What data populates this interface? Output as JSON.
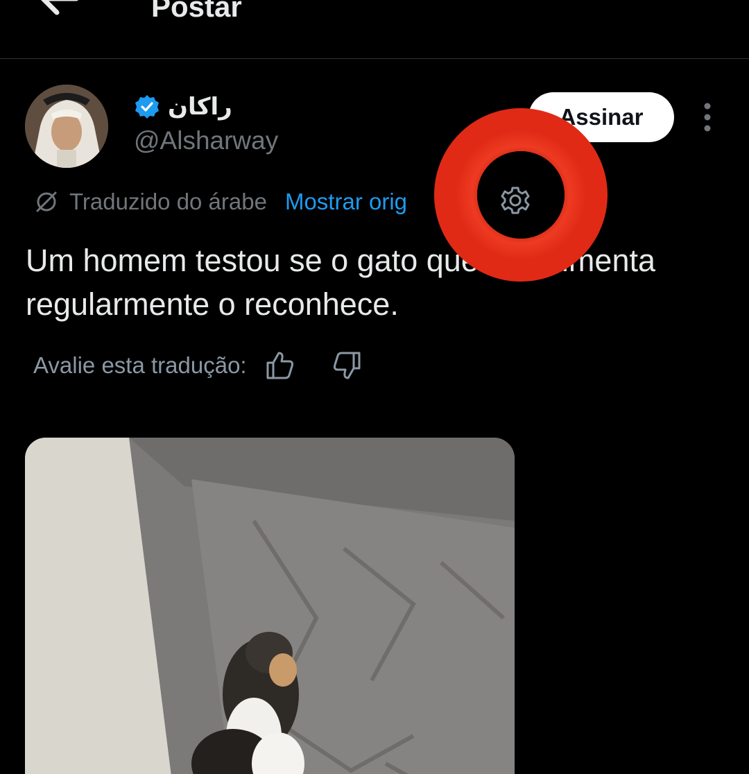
{
  "header": {
    "title": "Postar",
    "back_icon": "arrow-left-icon"
  },
  "author": {
    "display_name": "راكان",
    "handle": "@Alsharway",
    "verified_icon": "verified-badge-icon",
    "verified_color": "#1d9bf0"
  },
  "actions": {
    "subscribe_label": "Assinar",
    "more_icon": "more-vertical-icon"
  },
  "translation": {
    "icon": "translate-icon",
    "label": "Traduzido do árabe",
    "show_original": "Mostrar orig",
    "link_color": "#1d9bf0"
  },
  "tweet": {
    "text": "Um homem testou se o gato        que ele alimenta regularmente o reconhece."
  },
  "rating": {
    "label": "Avalie esta tradução:",
    "thumb_up_icon": "thumbs-up-icon",
    "thumb_down_icon": "thumbs-down-icon"
  },
  "overlay": {
    "ring_color": "#e8321f",
    "center_icon": "gear-icon"
  },
  "colors": {
    "background": "#000000",
    "primary_text": "#e7e9ea",
    "secondary_text": "#71767b",
    "accent": "#1d9bf0"
  }
}
